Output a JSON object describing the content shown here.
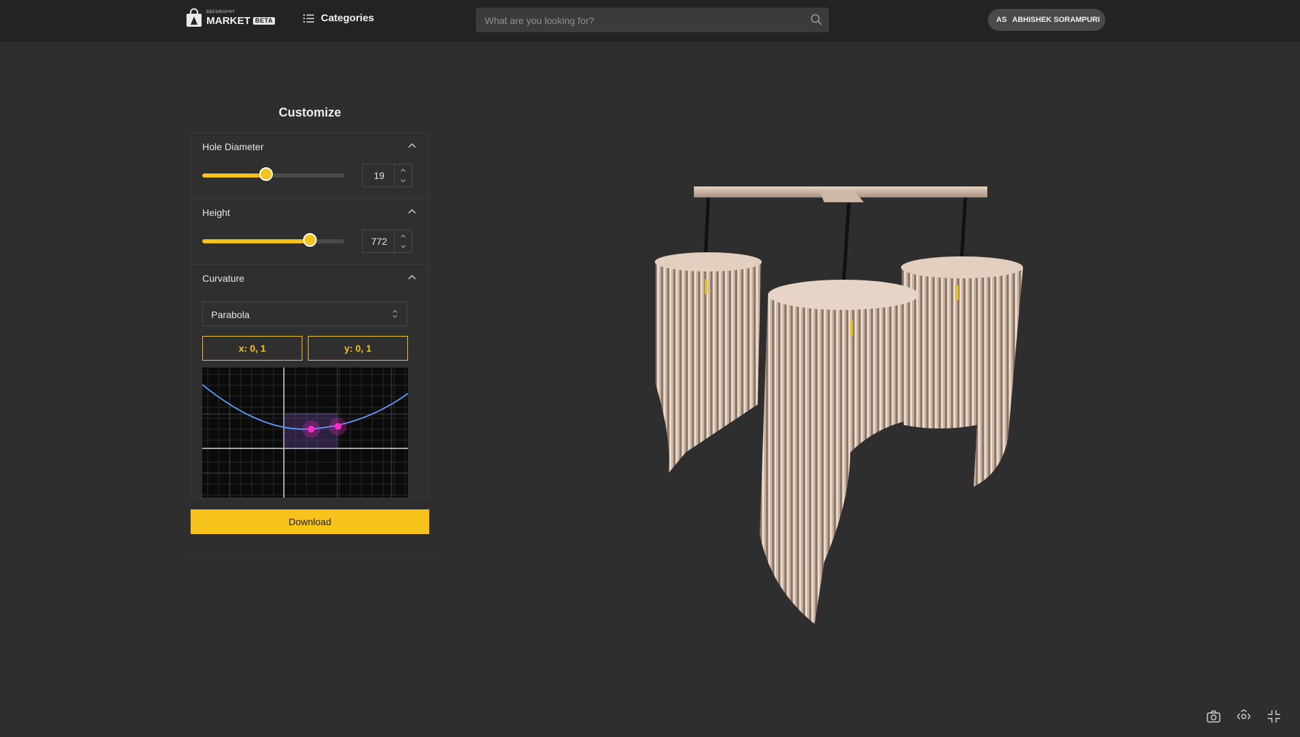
{
  "header": {
    "logo_small": "BEEGRAPHY",
    "logo_main": "MARKET",
    "logo_badge": "BETA",
    "categories_label": "Categories",
    "search_placeholder": "What are you looking for?",
    "user_initials": "AS",
    "user_name": "ABHISHEK SORAMPURI"
  },
  "panel": {
    "title": "Customize",
    "hole_diameter": {
      "label": "Hole Diameter",
      "value": "19",
      "level": 0.45
    },
    "height": {
      "label": "Height",
      "value": "772",
      "level": 0.76
    },
    "curvature": {
      "label": "Curvature",
      "select_value": "Parabola",
      "x_button": "x: 0, 1",
      "y_button": "y: 0, 1"
    },
    "download_label": "Download"
  },
  "viewer": {
    "tools": [
      "screenshot-icon",
      "focus-icon",
      "exit-fullscreen-icon"
    ]
  },
  "colors": {
    "accent": "#f7c31a",
    "background": "#2e2e2e",
    "topbar": "#232323",
    "curve": "#5aa0ff",
    "handle": "#ff2bc8",
    "model": "#d9c4b4"
  }
}
